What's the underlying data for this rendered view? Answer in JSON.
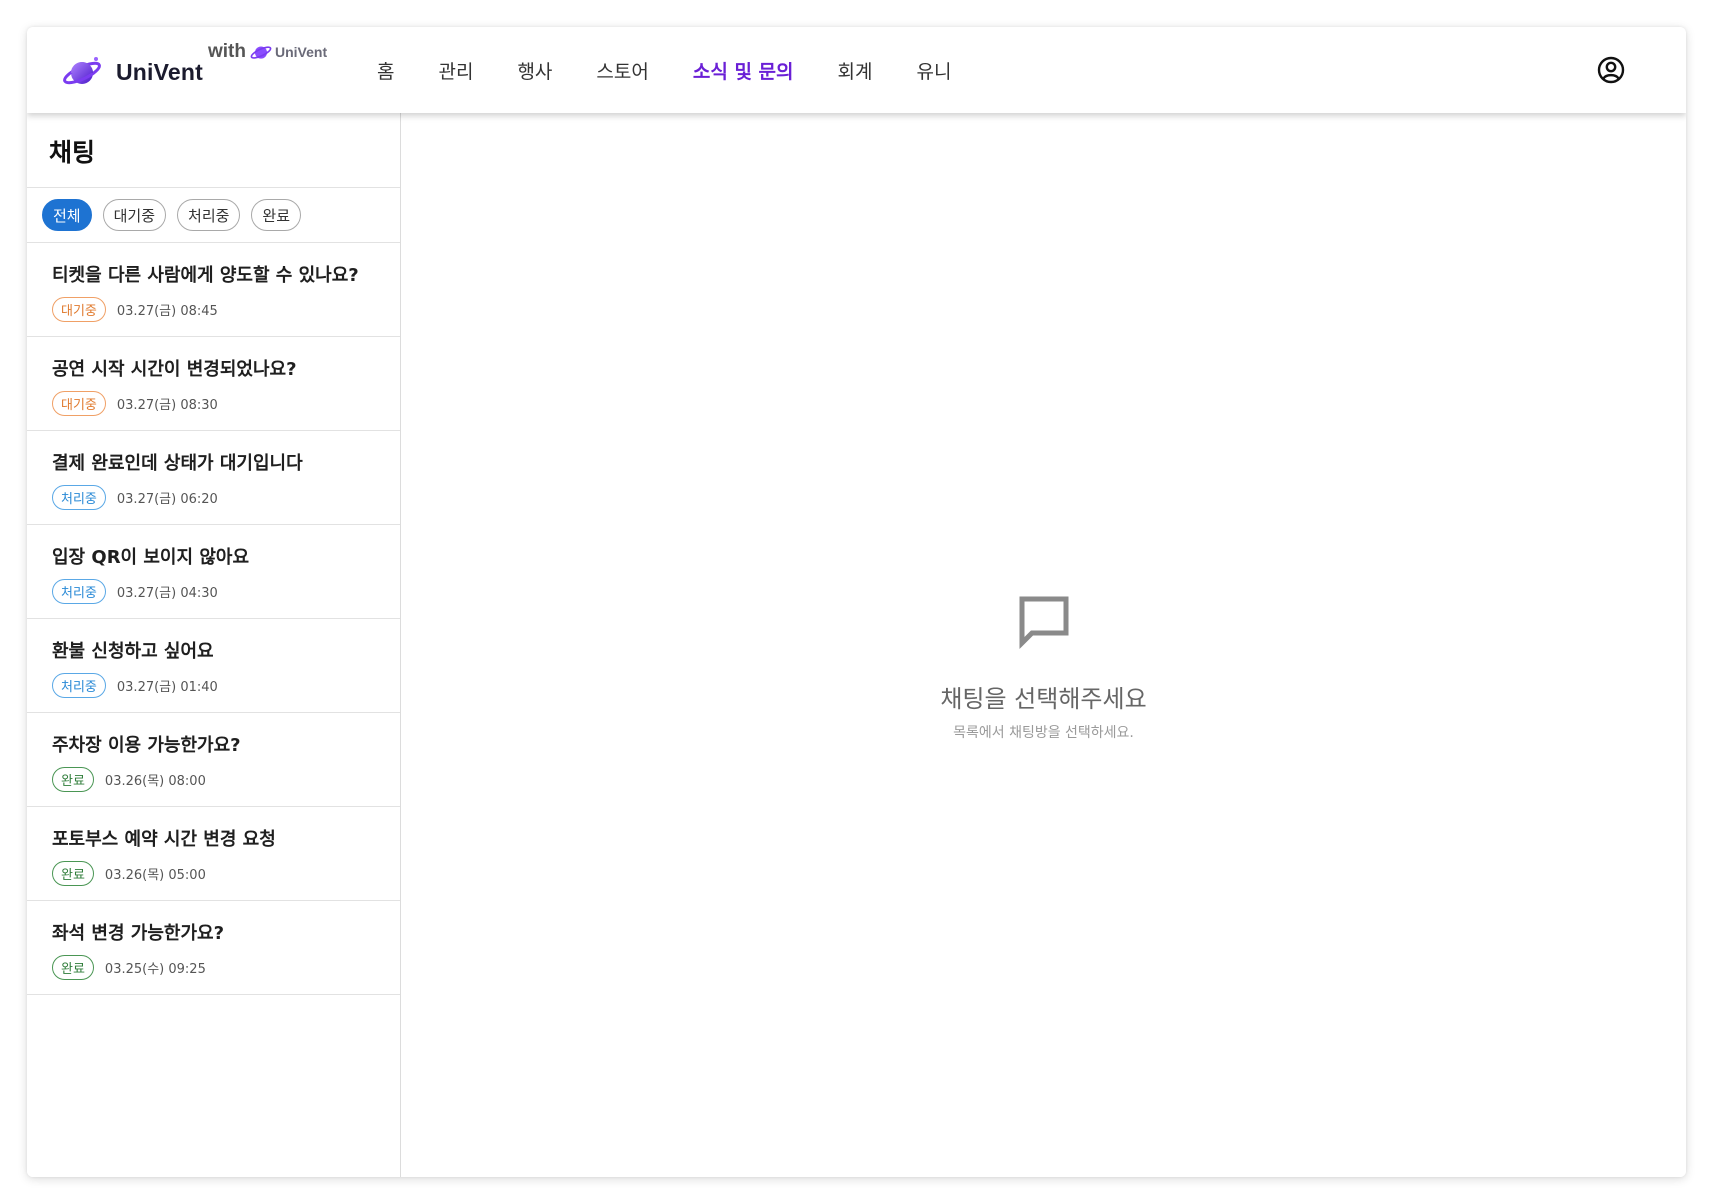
{
  "header": {
    "brand_name": "UniVent",
    "with_text": "with",
    "with_brand": "UniVent",
    "nav": [
      {
        "label": "홈",
        "active": false
      },
      {
        "label": "관리",
        "active": false
      },
      {
        "label": "행사",
        "active": false
      },
      {
        "label": "스토어",
        "active": false
      },
      {
        "label": "소식 및 문의",
        "active": true
      },
      {
        "label": "회계",
        "active": false
      },
      {
        "label": "유니",
        "active": false
      }
    ],
    "profile_icon": "user-circle-icon",
    "accent_color": "#6a1fd6"
  },
  "sidebar": {
    "title": "채팅",
    "filters": [
      {
        "label": "전체",
        "active": true
      },
      {
        "label": "대기중",
        "active": false
      },
      {
        "label": "처리중",
        "active": false
      },
      {
        "label": "완료",
        "active": false
      }
    ],
    "chats": [
      {
        "title": "티켓을 다른 사람에게 양도할 수 있나요?",
        "status": "대기중",
        "status_type": "waiting",
        "date": "03.27(금) 08:45"
      },
      {
        "title": "공연 시작 시간이 변경되었나요?",
        "status": "대기중",
        "status_type": "waiting",
        "date": "03.27(금) 08:30"
      },
      {
        "title": "결제 완료인데 상태가 대기입니다",
        "status": "처리중",
        "status_type": "processing",
        "date": "03.27(금) 06:20"
      },
      {
        "title": "입장 QR이 보이지 않아요",
        "status": "처리중",
        "status_type": "processing",
        "date": "03.27(금) 04:30"
      },
      {
        "title": "환불 신청하고 싶어요",
        "status": "처리중",
        "status_type": "processing",
        "date": "03.27(금) 01:40"
      },
      {
        "title": "주차장 이용 가능한가요?",
        "status": "완료",
        "status_type": "done",
        "date": "03.26(목) 08:00"
      },
      {
        "title": "포토부스 예약 시간 변경 요청",
        "status": "완료",
        "status_type": "done",
        "date": "03.26(목) 05:00"
      },
      {
        "title": "좌석 변경 가능한가요?",
        "status": "완료",
        "status_type": "done",
        "date": "03.25(수) 09:25"
      }
    ]
  },
  "main": {
    "empty_icon": "chat-bubble-icon",
    "empty_title": "채팅을 선택해주세요",
    "empty_subtitle": "목록에서 채팅방을 선택하세요."
  }
}
